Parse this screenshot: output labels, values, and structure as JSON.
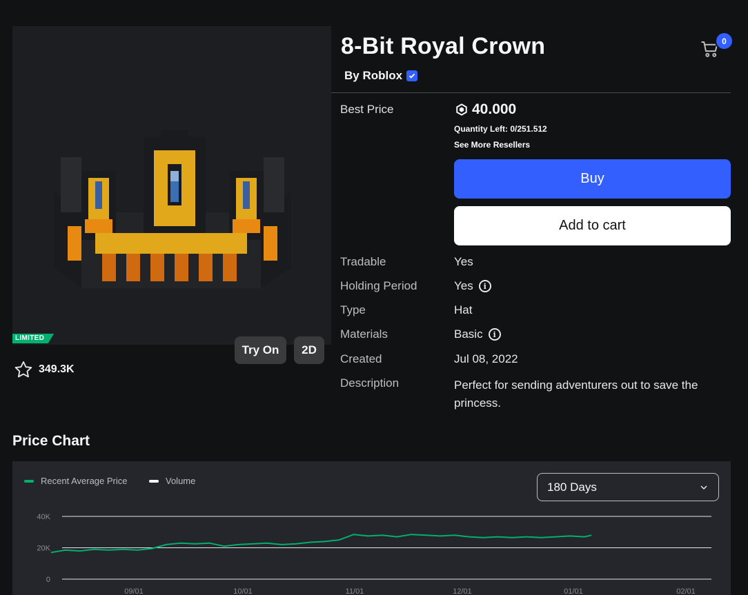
{
  "item": {
    "title": "8-Bit Royal Crown",
    "creator": "By Roblox",
    "badge": "LIMITED",
    "favorites": "349.3K"
  },
  "thumbnail": {
    "try_on": "Try On",
    "view_2d": "2D"
  },
  "cart": {
    "count": "0"
  },
  "purchase": {
    "best_price_label": "Best Price",
    "price": "40.000",
    "quantity_left": "Quantity Left: 0/251.512",
    "see_more": "See More Resellers",
    "buy": "Buy",
    "add_to_cart": "Add to cart"
  },
  "details": [
    {
      "label": "Tradable",
      "value": "Yes"
    },
    {
      "label": "Holding Period",
      "value": "Yes"
    },
    {
      "label": "Type",
      "value": "Hat"
    },
    {
      "label": "Materials",
      "value": "Basic"
    },
    {
      "label": "Created",
      "value": "Jul 08, 2022"
    },
    {
      "label": "Description",
      "value": "Perfect for sending adventurers out to save the princess."
    }
  ],
  "price_chart": {
    "title": "Price Chart",
    "legend": [
      "Recent Average Price",
      "Volume"
    ],
    "range_select": "180 Days",
    "colors": {
      "price": "#00b06f",
      "volume": "#ffffff"
    }
  },
  "chart_data": {
    "type": "line",
    "yticks": [
      "40K",
      "20K",
      "0"
    ],
    "ylim": [
      0,
      40000
    ],
    "xticks": [
      "09/01",
      "10/01",
      "11/01",
      "12/01",
      "01/01",
      "02/01"
    ],
    "series": [
      {
        "name": "Recent Average Price",
        "x": [
          "08/09",
          "08/13",
          "08/17",
          "08/21",
          "08/25",
          "08/29",
          "09/02",
          "09/06",
          "09/10",
          "09/14",
          "09/18",
          "09/22",
          "09/26",
          "09/30",
          "10/04",
          "10/08",
          "10/12",
          "10/16",
          "10/20",
          "10/24",
          "10/28",
          "11/01",
          "11/05",
          "11/09",
          "11/13",
          "11/17",
          "11/21",
          "11/25",
          "11/29",
          "12/03",
          "12/07",
          "12/11",
          "12/15",
          "12/19",
          "12/23",
          "12/27",
          "12/31",
          "01/04",
          "01/06"
        ],
        "values": [
          17000,
          18500,
          18000,
          19000,
          18500,
          19000,
          18500,
          19500,
          22000,
          23000,
          22500,
          23000,
          21000,
          22000,
          22500,
          23000,
          22000,
          22500,
          23500,
          24000,
          25000,
          28500,
          27500,
          28000,
          27000,
          28500,
          28000,
          27500,
          28000,
          27000,
          26500,
          27000,
          26500,
          27000,
          26500,
          27000,
          27500,
          27000,
          28000
        ]
      }
    ]
  }
}
